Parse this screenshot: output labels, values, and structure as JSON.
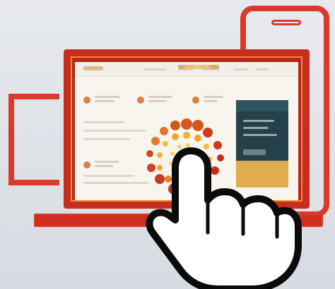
{
  "scene": {
    "description_colors": {
      "device_red": "#d93a2b",
      "laptop_red": "#c72e1f",
      "accent_orange": "#ef8d2d",
      "panel_teal": "#24404a",
      "panel_gold": "#e0ac4d",
      "hand_black": "#0b0b0b"
    }
  }
}
